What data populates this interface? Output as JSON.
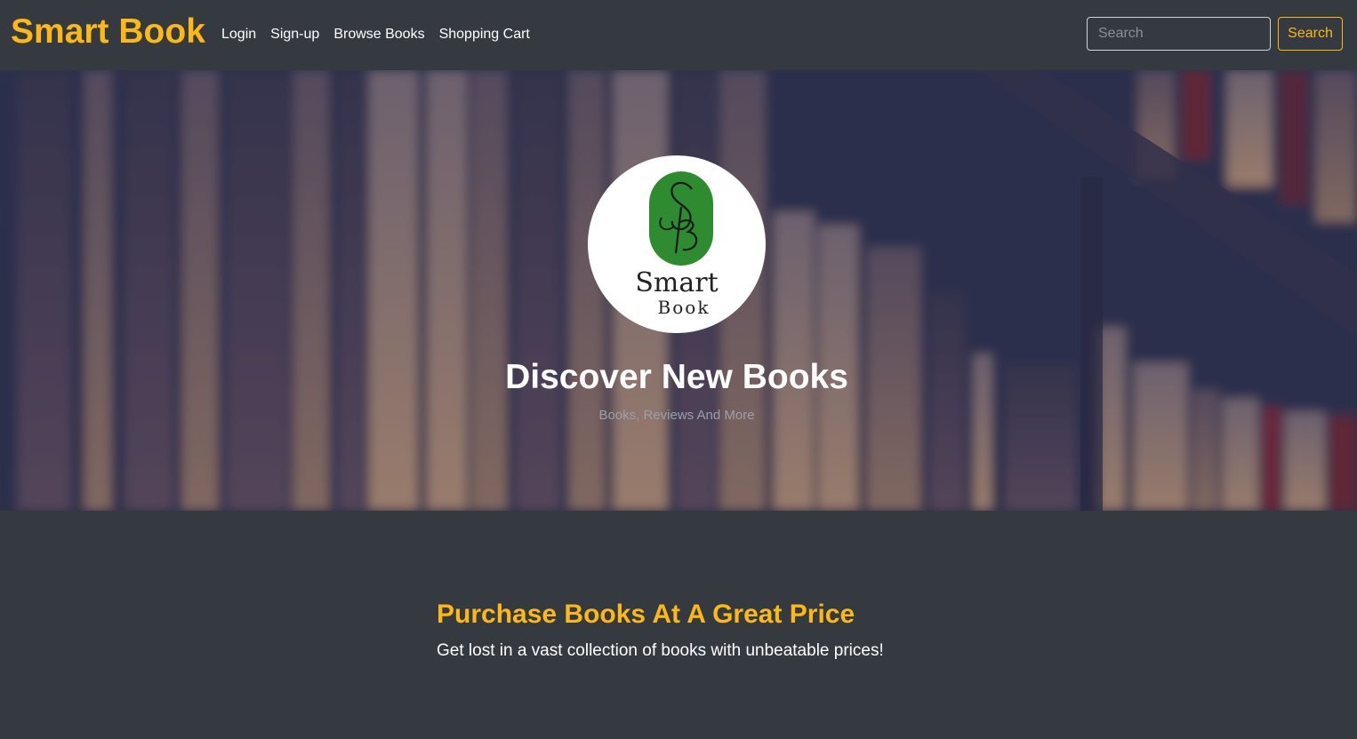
{
  "navbar": {
    "brand": "Smart Book",
    "links": [
      "Login",
      "Sign-up",
      "Browse Books",
      "Shopping Cart"
    ],
    "search": {
      "placeholder": "Search",
      "button_label": "Search"
    }
  },
  "hero": {
    "logo": {
      "line1": "Smart",
      "line2": "Book",
      "monogram": "SB"
    },
    "title": "Discover New Books",
    "subtitle": "Books, Reviews And More"
  },
  "section": {
    "title": "Purchase Books At A Great Price",
    "text": "Get lost in a vast collection of books with unbeatable prices!"
  },
  "colors": {
    "accent": "#fcb814",
    "navbar_bg": "#343a40",
    "logo_green": "#2e8b30"
  },
  "icons": {
    "hero_background": "bookshelf-photo"
  }
}
